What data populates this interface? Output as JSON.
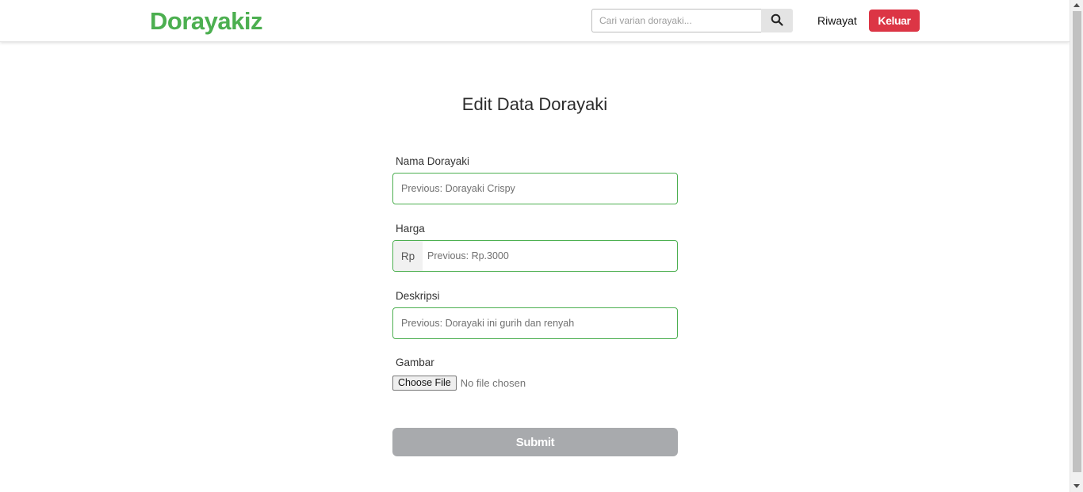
{
  "navbar": {
    "brand": "Dorayakiz",
    "search": {
      "placeholder": "Cari varian dorayaki...",
      "value": "",
      "button_icon": "search-icon"
    },
    "history_link": "Riwayat",
    "logout_label": "Keluar"
  },
  "page": {
    "title": "Edit Data Dorayaki"
  },
  "form": {
    "name": {
      "label": "Nama Dorayaki",
      "placeholder": "Previous: Dorayaki Crispy",
      "value": ""
    },
    "price": {
      "label": "Harga",
      "prefix": "Rp",
      "placeholder": "Previous: Rp.3000",
      "value": ""
    },
    "description": {
      "label": "Deskripsi",
      "placeholder": "Previous: Dorayaki ini gurih dan renyah",
      "value": ""
    },
    "image": {
      "label": "Gambar",
      "button_label": "Choose File",
      "status": "No file chosen"
    },
    "submit_label": "Submit"
  },
  "colors": {
    "brand": "#4caf50",
    "field_border": "#4caf50",
    "logout": "#dc3545",
    "submit_disabled": "#a8aaad"
  }
}
